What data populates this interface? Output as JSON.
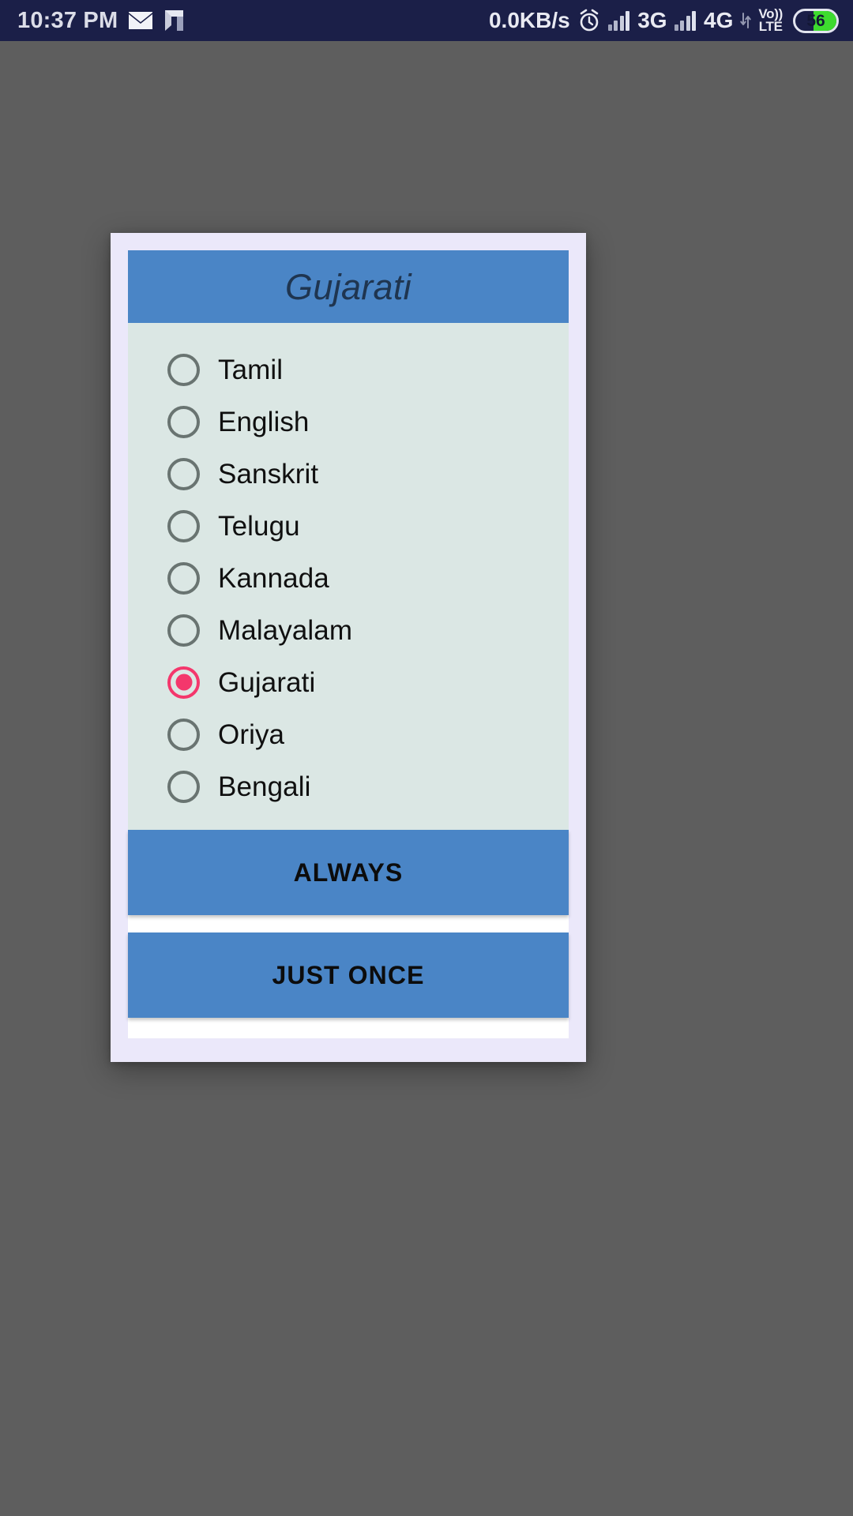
{
  "status_bar": {
    "time": "10:37 PM",
    "mail_icon": "envelope-icon",
    "app_icon": "n-logo-icon",
    "network_speed": "0.0KB/s",
    "alarm_icon": "alarm-clock-icon",
    "sim1_network": "3G",
    "sim2_network": "4G",
    "data_arrows_icon": "data-transfer-arrows-icon",
    "volte_top": "Vo))",
    "volte_bottom": "LTE",
    "battery_percent": "56",
    "battery_level_fraction": 0.56,
    "background_color": "#1b1f48",
    "text_color": "#e9eaf2",
    "battery_fill_color": "#3ddb2f"
  },
  "scrim": {
    "color": "#5e5e5e"
  },
  "dialog": {
    "border_color": "#ebe8fa",
    "header": {
      "title": "Gujarati",
      "background_color": "#4a85c6",
      "text_color": "#1f3550"
    },
    "list": {
      "background_color": "#dbe7e4",
      "radio_unchecked_color": "#697471",
      "radio_checked_color": "#f4376c",
      "label_color": "#101010",
      "items": [
        {
          "label": "Tamil",
          "selected": false
        },
        {
          "label": "English",
          "selected": false
        },
        {
          "label": "Sanskrit",
          "selected": false
        },
        {
          "label": "Telugu",
          "selected": false
        },
        {
          "label": "Kannada",
          "selected": false
        },
        {
          "label": "Malayalam",
          "selected": false
        },
        {
          "label": "Gujarati",
          "selected": true
        },
        {
          "label": "Oriya",
          "selected": false
        },
        {
          "label": "Bengali",
          "selected": false
        }
      ]
    },
    "buttons": {
      "always_label": "ALWAYS",
      "just_once_label": "JUST ONCE",
      "background_color": "#4a85c6",
      "text_color": "#0c0c0c"
    }
  }
}
